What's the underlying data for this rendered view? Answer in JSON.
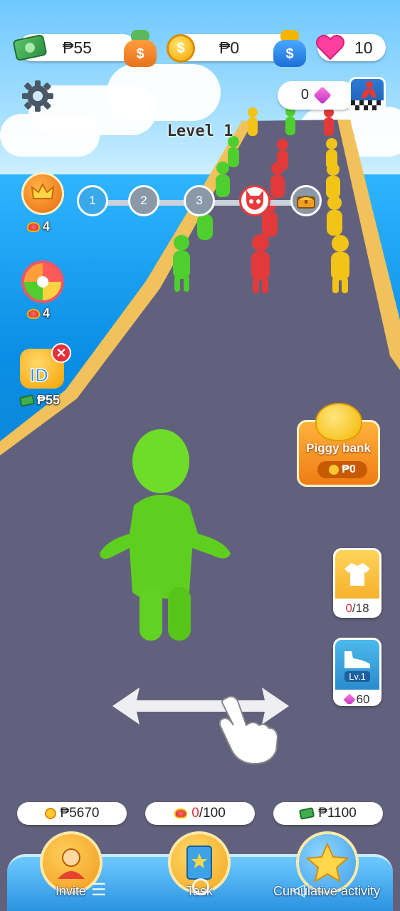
{
  "header": {
    "cash_value": "₱55",
    "coin_value": "₱0",
    "lives_value": "10",
    "gems_value": "0"
  },
  "level": {
    "title": "Level 1",
    "stages": [
      "1",
      "2",
      "3"
    ]
  },
  "left_rewards": {
    "crown_count": "4",
    "wheel_count": "4",
    "id_reward": "₱55"
  },
  "piggy_bank": {
    "label": "Piggy bank",
    "amount": "₱0"
  },
  "skins": {
    "progress": "0/18",
    "progress_current": "0",
    "progress_total": "/18"
  },
  "upgrade": {
    "level": "Lv.1",
    "cost": "60"
  },
  "bottom": {
    "invite_reward": "₱5670",
    "task_progress_current": "0",
    "task_progress_total": "/100",
    "activity_reward": "₱1100",
    "invite_label": "Invite",
    "task_label": "Task",
    "activity_label": "Cumulative activity"
  },
  "colors": {
    "road": "#62617d",
    "road_edge": "#f1c15b",
    "hero": "#6fdc2a",
    "green_team": "#4fcf2d",
    "red_team": "#e23a3a",
    "yellow_team": "#f2c417",
    "accent_blue": "#3aa9ea"
  },
  "icons": {
    "settings": "gear-icon",
    "cash": "cash-icon",
    "coin": "coin-icon",
    "heart": "heart-icon",
    "gem": "gem-icon",
    "boss": "devil-skull-icon",
    "chest": "treasure-chest-icon"
  }
}
